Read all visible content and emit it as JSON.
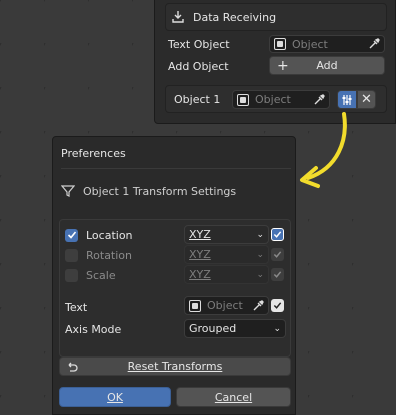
{
  "receiving_panel": {
    "header_label": "Data Receiving",
    "text_object_label": "Text Object",
    "text_object_placeholder": "Object",
    "add_object_label": "Add Object",
    "add_button_label": "Add",
    "object1_label": "Object 1",
    "object1_placeholder": "Object"
  },
  "preferences": {
    "title": "Preferences",
    "transform_header": "Object 1 Transform Settings",
    "location": {
      "label": "Location",
      "checked": true,
      "axes": "XYZ",
      "axes_checked": true
    },
    "rotation": {
      "label": "Rotation",
      "checked": false,
      "axes": "XYZ",
      "axes_checked": true
    },
    "scale": {
      "label": "Scale",
      "checked": false,
      "axes": "XYZ",
      "axes_checked": true
    },
    "text": {
      "label": "Text",
      "placeholder": "Object",
      "checked": true
    },
    "axis_mode": {
      "label": "Axis Mode",
      "value": "Grouped"
    },
    "reset_label": "Reset Transforms",
    "ok_label": "OK",
    "cancel_label": "Cancel"
  },
  "colors": {
    "accent_blue": "#4772b3",
    "arrow_yellow": "#f2dc2c",
    "panel_bg": "#2b2b2b"
  },
  "icons": [
    "download-icon",
    "object-icon",
    "eyedropper-icon",
    "plus-icon",
    "sliders-icon",
    "close-icon",
    "funnel-icon",
    "check-icon",
    "chevron-down-icon",
    "reset-icon",
    "curved-arrow-icon"
  ]
}
